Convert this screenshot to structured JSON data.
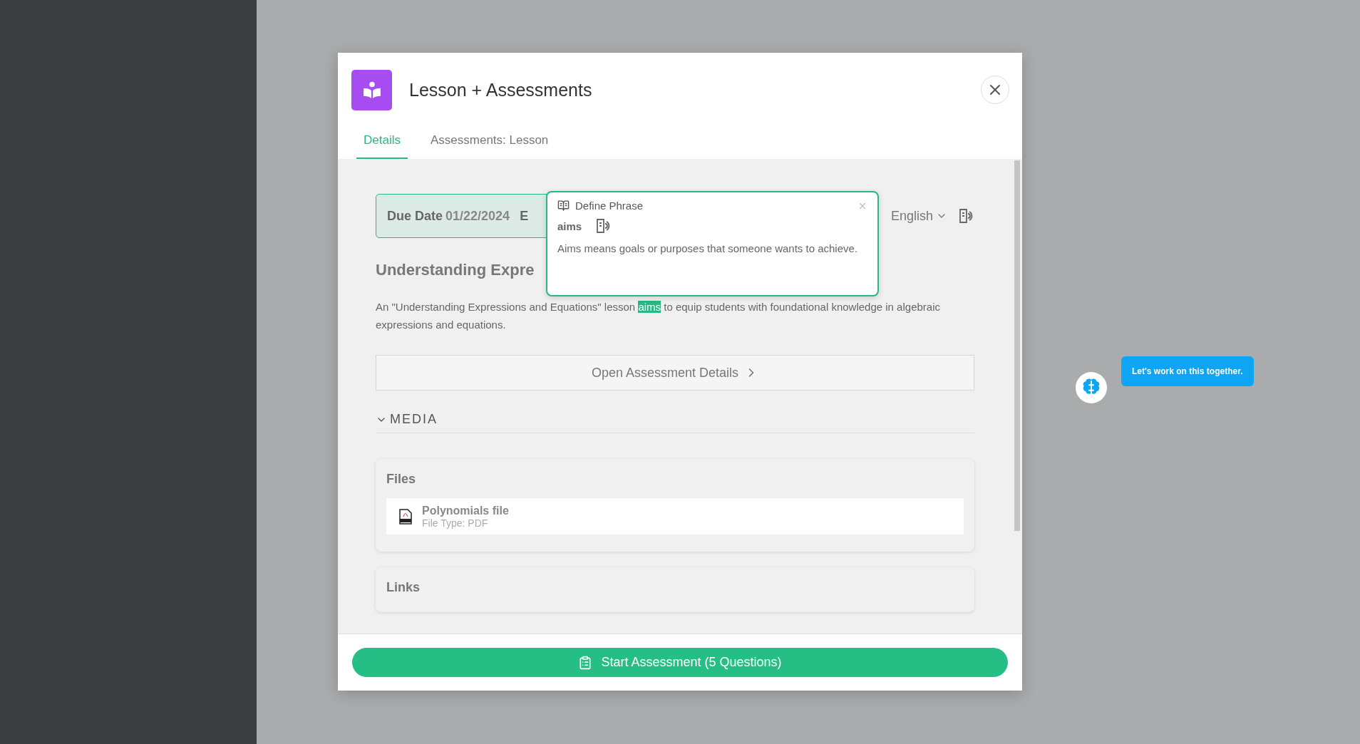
{
  "modal": {
    "title": "Lesson + Assessments",
    "tabs": [
      {
        "label": "Details",
        "selected": true
      },
      {
        "label": "Assessments: Lesson",
        "selected": false
      }
    ],
    "due_date": {
      "label": "Due Date",
      "value": "01/22/2024",
      "cut_text": "E"
    },
    "language": "English",
    "lesson_title": "Understanding Expre",
    "description": {
      "before": "An \"Understanding Expressions and Equations\" lesson ",
      "highlight": "aims",
      "after": " to equip students with foundational knowledge in algebraic expressions and equations."
    },
    "open_details_button": "Open Assessment Details",
    "media": {
      "label": "MEDIA",
      "expanded": true,
      "sections": [
        {
          "title": "Files",
          "files": [
            {
              "name": "Polynomials file",
              "type": "File Type: PDF"
            }
          ]
        },
        {
          "title": "Links"
        }
      ]
    },
    "start_button": "Start Assessment (5 Questions)"
  },
  "define_popup": {
    "title": "Define Phrase",
    "term": "aims",
    "definition": "Aims means goals or purposes that someone wants to achieve."
  },
  "assistant": {
    "message": "Let's work on this together."
  }
}
